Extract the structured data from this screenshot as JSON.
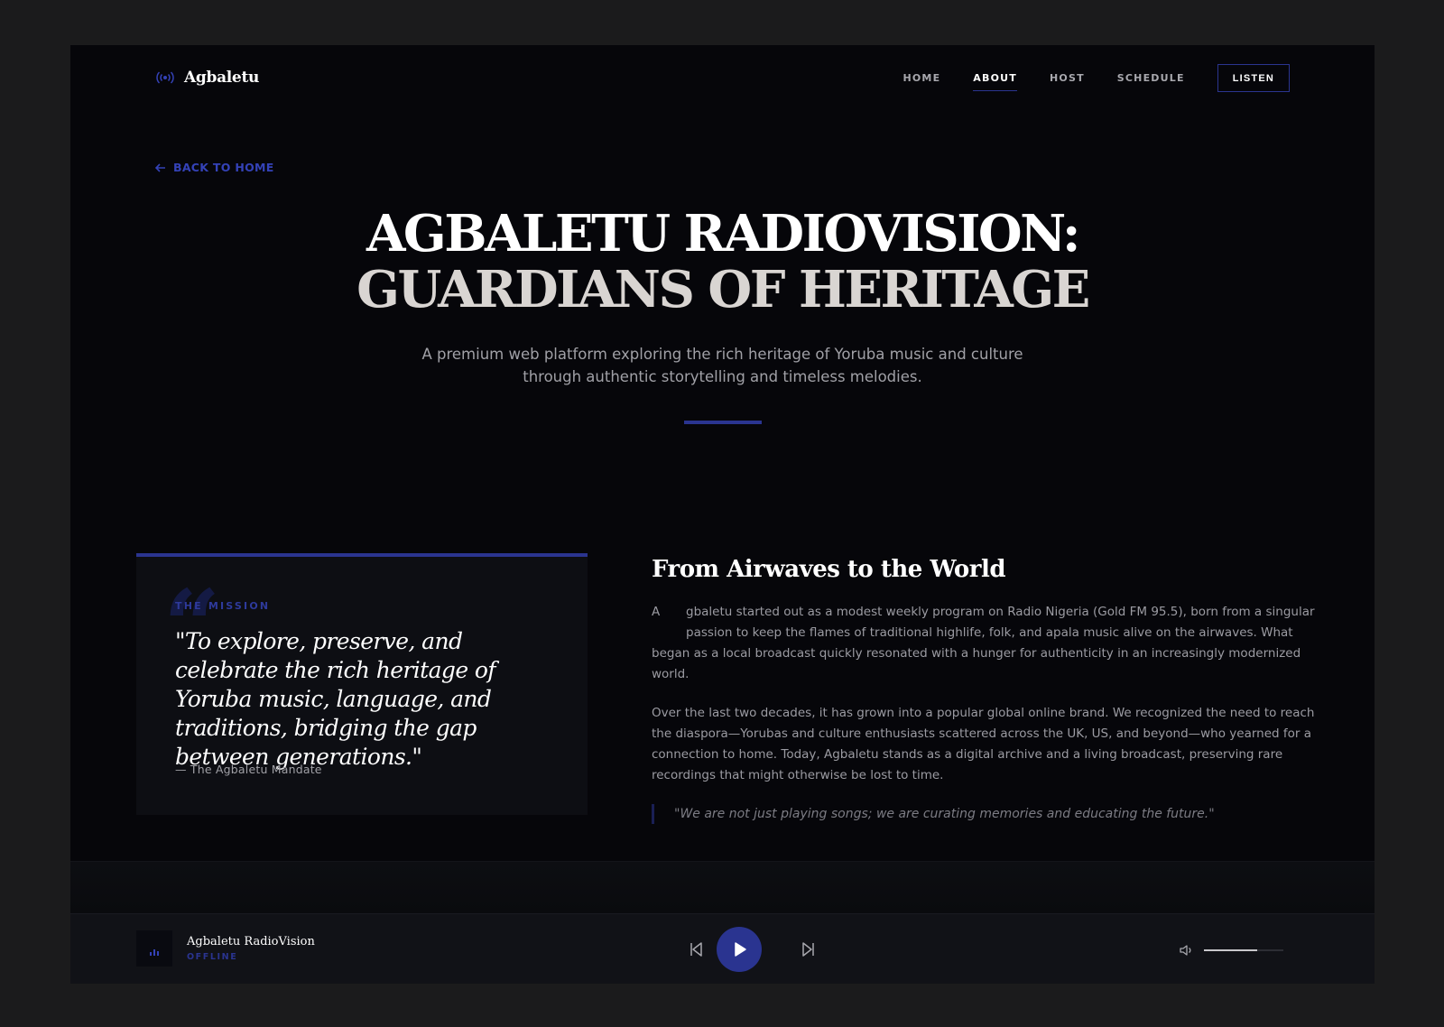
{
  "nav": {
    "brand": "Agbaletu",
    "links": [
      "HOME",
      "ABOUT",
      "HOST",
      "SCHEDULE"
    ],
    "active": "ABOUT",
    "cta": "LISTEN"
  },
  "back": {
    "label": "BACK TO HOME"
  },
  "hero": {
    "title_line1": "AGBALETU RADIOVISION:",
    "title_line2": "GUARDIANS OF HERITAGE",
    "subtitle": "A premium web platform exploring the rich heritage of Yoruba music and culture through authentic storytelling and timeless melodies."
  },
  "mission": {
    "label": "THE MISSION",
    "quote": "\"To explore, preserve, and celebrate the rich heritage of Yoruba music, language, and traditions, bridging the gap between generations.\"",
    "signature": "— The Agbaletu Mandate"
  },
  "story": {
    "title": "From Airwaves to the World",
    "p1_dropcap": "A",
    "p1_first": "gbaletu started out as a modest weekly program on Radio Nigeria (Gold FM 95.5), born from a singular passion to keep the flames of traditional highlife, folk, and apala music alive on the airwaves. What",
    "p1_rest": "began as a local broadcast quickly resonated with a hunger for authenticity in an increasingly modernized world.",
    "p2": "Over the last two decades, it has grown into a popular global online brand. We recognized the need to reach the diaspora—Yorubas and culture enthusiasts scattered across the UK, US, and beyond—who yearned for a connection to home. Today, Agbaletu stands as a digital archive and a living broadcast, preserving rare recordings that might otherwise be lost to time.",
    "pull_quote": "\"We are not just playing songs; we are curating memories and educating the future.\""
  },
  "player": {
    "station": "Agbaletu RadioVision",
    "status": "OFFLINE",
    "volume": 0.67
  },
  "icons": {
    "brand": "radio-waves-icon",
    "back": "arrow-left-icon",
    "prev": "skip-back-icon",
    "play": "play-icon",
    "next": "skip-forward-icon",
    "volume": "volume-icon",
    "art": "equalizer-bars-icon"
  },
  "colors": {
    "accent": "#2a3490",
    "accent_text": "#3442b8",
    "background": "#06060a",
    "card": "#0d0e13",
    "player": "#111217"
  }
}
